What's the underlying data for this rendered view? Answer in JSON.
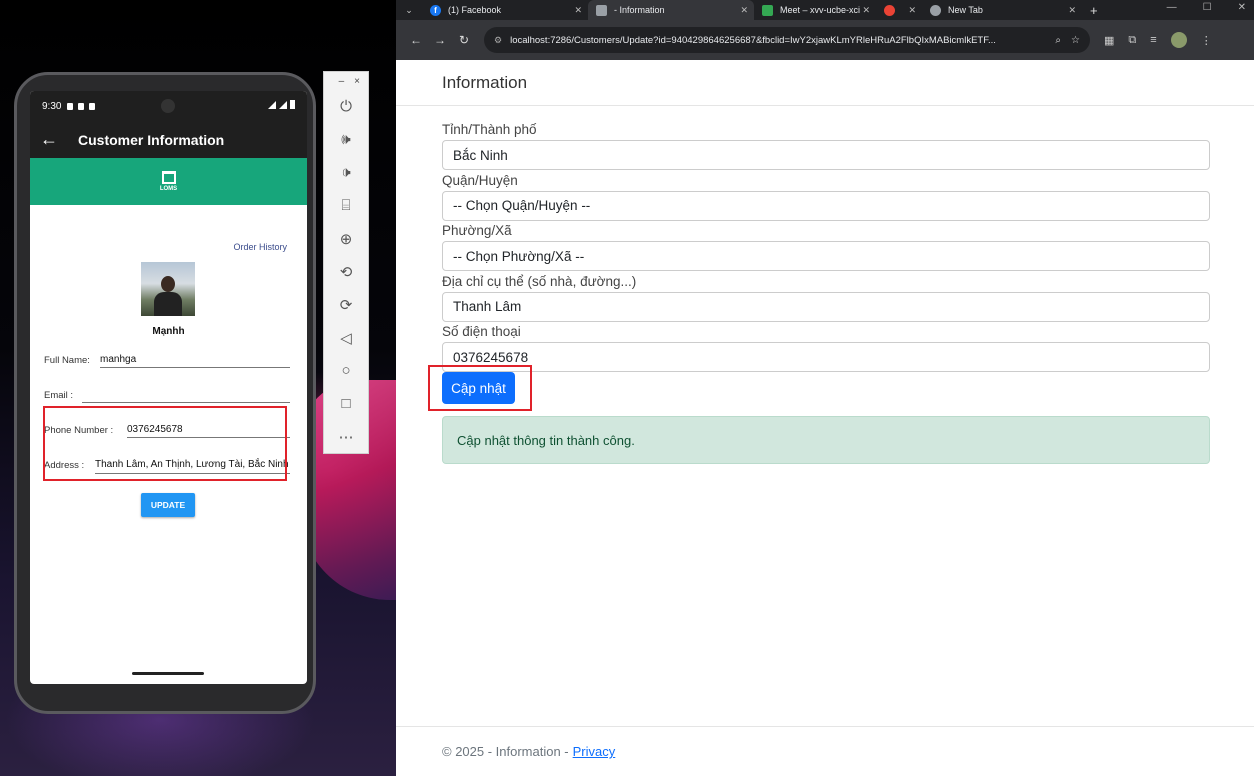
{
  "browser": {
    "tabs": [
      {
        "label": "(1) Facebook",
        "icon": "facebook-icon",
        "icon_color": "#1877f2"
      },
      {
        "label": "- Information",
        "icon": "page-icon",
        "icon_color": "#9aa0a6",
        "active": true
      },
      {
        "label": "Meet – xvv-ucbe-xci",
        "icon": "meet-icon",
        "icon_color": "#34a853"
      },
      {
        "label": "",
        "icon": "recording-icon",
        "icon_color": "#ea4335"
      },
      {
        "label": "New Tab",
        "icon": "chrome-icon",
        "icon_color": "#9aa0a6"
      }
    ],
    "url": "localhost:7286/Customers/Update?id=940429864625668​7&fbclid=IwY2xjawKLmYRleHRuA2FlbQIxMABicmlkETF..."
  },
  "web": {
    "brand": "Information",
    "labels": {
      "province": "Tỉnh/Thành phố",
      "district": "Quận/Huyện",
      "ward": "Phường/Xã",
      "address": "Địa chỉ cụ thể (số nhà, đường...)",
      "phone": "Số điện thoại"
    },
    "values": {
      "province": "Bắc Ninh",
      "district": "-- Chọn Quận/Huyện --",
      "ward": "-- Chọn Phường/Xã --",
      "address": "Thanh Lâm",
      "phone": "0376245678"
    },
    "submit_label": "Cập nhật",
    "success_message": "Cập nhật thông tin thành công.",
    "footer_text": "© 2025 - Information -",
    "footer_link": "Privacy"
  },
  "phone": {
    "time": "9:30",
    "title": "Customer Information",
    "logo_text": "LOMS",
    "order_history": "Order History",
    "name": "Mạnhh",
    "fields": {
      "fullname_label": "Full Name:",
      "fullname": "manhga",
      "email_label": "Email :",
      "email": "",
      "phone_label": "Phone Number :",
      "phone": "0376245678",
      "address_label": "Address :",
      "address": "Thanh Lâm, An Thịnh, Lương Tài, Bắc Ninh"
    },
    "update_label": "UPDATE"
  },
  "colors": {
    "accent": "#0d6efd",
    "app_green": "#17a67b",
    "highlight": "#e0222a",
    "success_bg": "#d1e7dd"
  }
}
